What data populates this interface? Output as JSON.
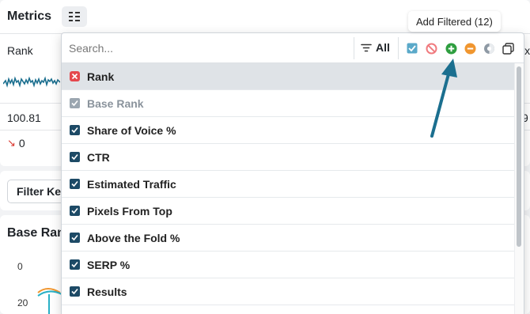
{
  "metrics": {
    "title": "Metrics",
    "rank_label": "Rank",
    "value": "100.81",
    "delta": "0",
    "right_edge_partial": "ix",
    "right_edge_value": "9"
  },
  "filter_button": {
    "label": "Filter Key"
  },
  "chart": {
    "title": "Base Rank",
    "y_ticks": [
      "0",
      "20"
    ]
  },
  "panel": {
    "search_placeholder": "Search...",
    "all_label": "All",
    "items": [
      {
        "label": "Rank",
        "state": "excluded"
      },
      {
        "label": "Base Rank",
        "state": "disabled"
      },
      {
        "label": "Share of Voice %",
        "state": "checked"
      },
      {
        "label": "CTR",
        "state": "checked"
      },
      {
        "label": "Estimated Traffic",
        "state": "checked"
      },
      {
        "label": "Pixels From Top",
        "state": "checked"
      },
      {
        "label": "Above the Fold %",
        "state": "checked"
      },
      {
        "label": "SERP %",
        "state": "checked"
      },
      {
        "label": "Results",
        "state": "checked"
      }
    ]
  },
  "tooltip": {
    "text": "Add Filtered (12)"
  },
  "colors": {
    "checkbox": "#1d4a66",
    "exclude": "#e5484d",
    "add": "#2e9e3f",
    "remove": "#f0962f",
    "arrow": "#1b6f8f"
  }
}
